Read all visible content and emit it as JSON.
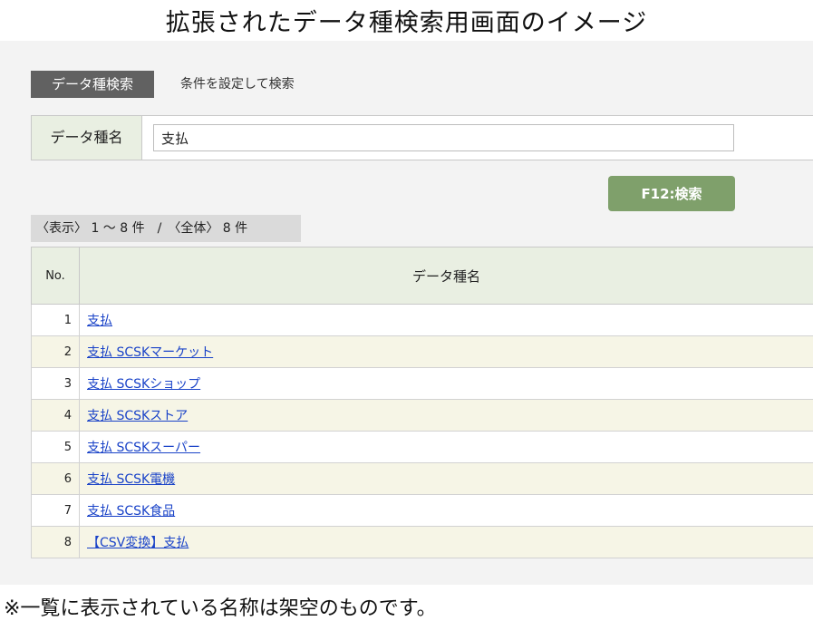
{
  "page_title": "拡張されたデータ種検索用画面のイメージ",
  "header": {
    "tab_label": "データ種検索",
    "subtitle": "条件を設定して検索"
  },
  "search": {
    "label": "データ種名",
    "value": "支払"
  },
  "search_button": "F12:検索",
  "result_count": "〈表示〉 1 〜 8 件　/　〈全体〉 8 件",
  "table": {
    "headers": {
      "no": "No.",
      "name": "データ種名"
    },
    "rows": [
      {
        "no": "1",
        "name": "支払"
      },
      {
        "no": "2",
        "name": "支払 SCSKマーケット"
      },
      {
        "no": "3",
        "name": "支払 SCSKショップ"
      },
      {
        "no": "4",
        "name": "支払 SCSKストア"
      },
      {
        "no": "5",
        "name": "支払 SCSKスーパー"
      },
      {
        "no": "6",
        "name": "支払 SCSK電機"
      },
      {
        "no": "7",
        "name": "支払 SCSK食品"
      },
      {
        "no": "8",
        "name": "【CSV変換】支払"
      }
    ]
  },
  "footnote": "※一覧に表示されている名称は架空のものです。",
  "colors": {
    "tab_bg": "#616161",
    "label_bg": "#e9efe2",
    "button_bg": "#7fa06b",
    "row_alt_bg": "#f6f5e6",
    "link": "#1a43c8"
  }
}
